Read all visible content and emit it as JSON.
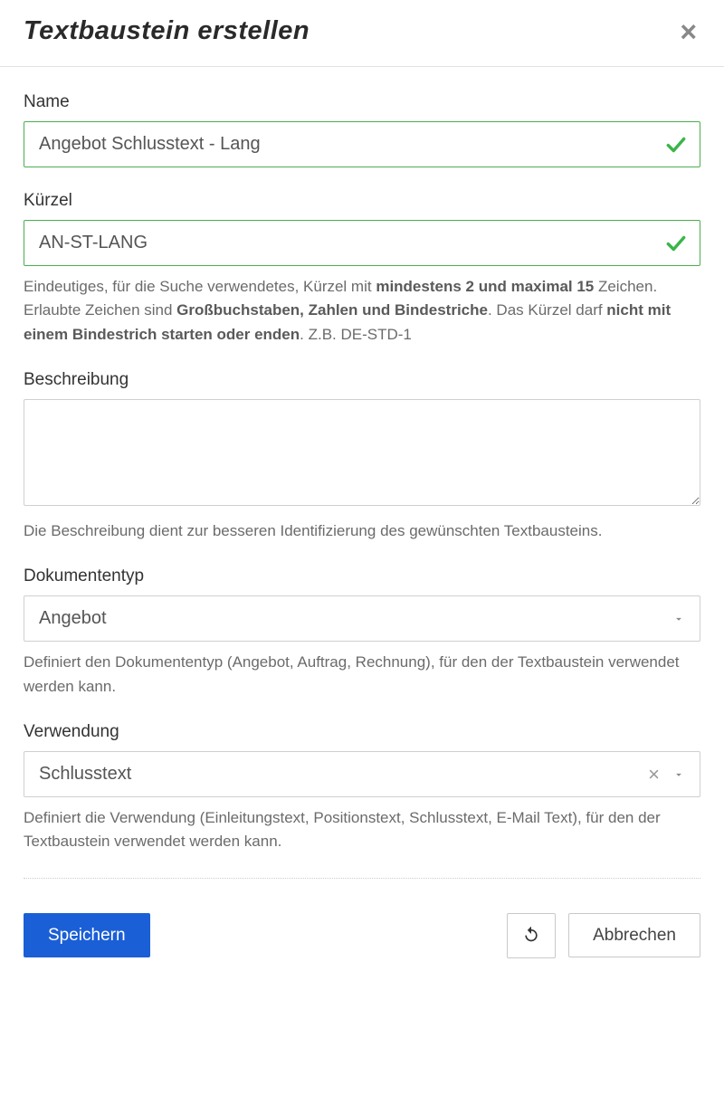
{
  "dialog": {
    "title": "Textbaustein erstellen"
  },
  "fields": {
    "name": {
      "label": "Name",
      "value": "Angebot Schlusstext - Lang"
    },
    "kuerzel": {
      "label": "Kürzel",
      "value": "AN-ST-LANG",
      "hint_p1": "Eindeutiges, für die Suche verwendetes, Kürzel mit ",
      "hint_b1": "mindestens 2 und maximal 15",
      "hint_p2": " Zeichen. Erlaubte Zeichen sind ",
      "hint_b2": "Großbuchstaben, Zahlen und Bindestriche",
      "hint_p3": ". Das Kürzel darf ",
      "hint_b3": "nicht mit einem Bindestrich starten oder enden",
      "hint_p4": ". Z.B. DE-STD-1"
    },
    "beschreibung": {
      "label": "Beschreibung",
      "value": "",
      "hint": "Die Beschreibung dient zur besseren Identifizierung des gewünschten Textbausteins."
    },
    "dokumententyp": {
      "label": "Dokumententyp",
      "value": "Angebot",
      "hint": "Definiert den Dokumententyp (Angebot, Auftrag, Rechnung), für den der Textbaustein verwendet werden kann."
    },
    "verwendung": {
      "label": "Verwendung",
      "value": "Schlusstext",
      "hint": "Definiert die Verwendung (Einleitungstext, Positionstext, Schlusstext, E-Mail Text), für den der Textbaustein verwendet werden kann."
    }
  },
  "footer": {
    "save": "Speichern",
    "cancel": "Abbrechen"
  }
}
